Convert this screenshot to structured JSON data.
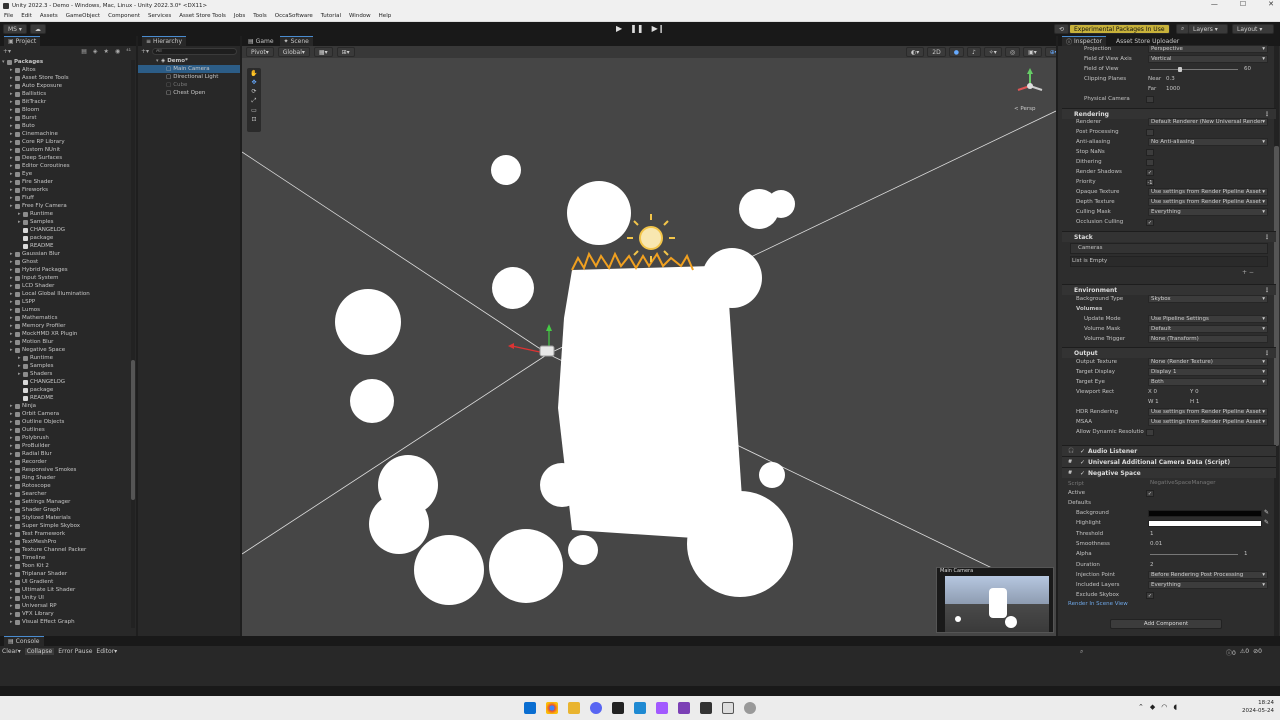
{
  "window": {
    "title": "Unity 2022.3 - Demo - Windows, Mac, Linux - Unity 2022.3.0* <DX11>"
  },
  "menu": [
    "File",
    "Edit",
    "Assets",
    "GameObject",
    "Component",
    "Services",
    "Asset Store Tools",
    "Jobs",
    "Tools",
    "OccaSoftware",
    "Tutorial",
    "Window",
    "Help"
  ],
  "toolbar": {
    "account": "MS",
    "experimental": "Experimental Packages In Use",
    "layers": "Layers",
    "layout": "Layout"
  },
  "project": {
    "tab": "Project",
    "root": "Packages",
    "items": [
      {
        "label": "Altos",
        "indent": 1
      },
      {
        "label": "Asset Store Tools",
        "indent": 1
      },
      {
        "label": "Auto Exposure",
        "indent": 1
      },
      {
        "label": "Ballistics",
        "indent": 1
      },
      {
        "label": "BitTrackr",
        "indent": 1
      },
      {
        "label": "Bloom",
        "indent": 1
      },
      {
        "label": "Burst",
        "indent": 1
      },
      {
        "label": "Buto",
        "indent": 1
      },
      {
        "label": "Cinemachine",
        "indent": 1
      },
      {
        "label": "Core RP Library",
        "indent": 1
      },
      {
        "label": "Custom NUnit",
        "indent": 1
      },
      {
        "label": "Deep Surfaces",
        "indent": 1
      },
      {
        "label": "Editor Coroutines",
        "indent": 1
      },
      {
        "label": "Eye",
        "indent": 1
      },
      {
        "label": "Fire Shader",
        "indent": 1
      },
      {
        "label": "Fireworks",
        "indent": 1
      },
      {
        "label": "Fluff",
        "indent": 1
      },
      {
        "label": "Free Fly Camera",
        "indent": 1
      },
      {
        "label": "Runtime",
        "indent": 2
      },
      {
        "label": "Samples",
        "indent": 2
      },
      {
        "label": "CHANGELOG",
        "indent": 2,
        "file": true
      },
      {
        "label": "package",
        "indent": 2,
        "file": true
      },
      {
        "label": "README",
        "indent": 2,
        "file": true
      },
      {
        "label": "Gaussian Blur",
        "indent": 1
      },
      {
        "label": "Ghost",
        "indent": 1
      },
      {
        "label": "Hybrid Packages",
        "indent": 1
      },
      {
        "label": "Input System",
        "indent": 1
      },
      {
        "label": "LCD Shader",
        "indent": 1
      },
      {
        "label": "Local Global Illumination",
        "indent": 1
      },
      {
        "label": "LSPP",
        "indent": 1
      },
      {
        "label": "Lumos",
        "indent": 1
      },
      {
        "label": "Mathematics",
        "indent": 1
      },
      {
        "label": "Memory Profiler",
        "indent": 1
      },
      {
        "label": "MockHMD XR Plugin",
        "indent": 1
      },
      {
        "label": "Motion Blur",
        "indent": 1
      },
      {
        "label": "Negative Space",
        "indent": 1
      },
      {
        "label": "Runtime",
        "indent": 2
      },
      {
        "label": "Samples",
        "indent": 2
      },
      {
        "label": "Shaders",
        "indent": 2
      },
      {
        "label": "CHANGELOG",
        "indent": 2,
        "file": true
      },
      {
        "label": "package",
        "indent": 2,
        "file": true
      },
      {
        "label": "README",
        "indent": 2,
        "file": true
      },
      {
        "label": "Ninja",
        "indent": 1
      },
      {
        "label": "Orbit Camera",
        "indent": 1
      },
      {
        "label": "Outline Objects",
        "indent": 1
      },
      {
        "label": "Outlines",
        "indent": 1
      },
      {
        "label": "Polybrush",
        "indent": 1
      },
      {
        "label": "ProBuilder",
        "indent": 1
      },
      {
        "label": "Radial Blur",
        "indent": 1
      },
      {
        "label": "Recorder",
        "indent": 1
      },
      {
        "label": "Responsive Smokes",
        "indent": 1
      },
      {
        "label": "Ring Shader",
        "indent": 1
      },
      {
        "label": "Rotoscope",
        "indent": 1
      },
      {
        "label": "Searcher",
        "indent": 1
      },
      {
        "label": "Settings Manager",
        "indent": 1
      },
      {
        "label": "Shader Graph",
        "indent": 1
      },
      {
        "label": "Stylized Materials",
        "indent": 1
      },
      {
        "label": "Super Simple Skybox",
        "indent": 1
      },
      {
        "label": "Test Framework",
        "indent": 1
      },
      {
        "label": "TextMeshPro",
        "indent": 1
      },
      {
        "label": "Texture Channel Packer",
        "indent": 1
      },
      {
        "label": "Timeline",
        "indent": 1
      },
      {
        "label": "Toon Kit 2",
        "indent": 1
      },
      {
        "label": "Triplanar Shader",
        "indent": 1
      },
      {
        "label": "UI Gradient",
        "indent": 1
      },
      {
        "label": "Ultimate Lit Shader",
        "indent": 1
      },
      {
        "label": "Unity UI",
        "indent": 1
      },
      {
        "label": "Universal RP",
        "indent": 1
      },
      {
        "label": "VFX Library",
        "indent": 1
      },
      {
        "label": "Visual Effect Graph",
        "indent": 1
      }
    ]
  },
  "hierarchy": {
    "tab": "Hierarchy",
    "search_placeholder": "All",
    "scene": "Demo*",
    "items": [
      {
        "label": "Main Camera",
        "selected": true
      },
      {
        "label": "Directional Light"
      },
      {
        "label": "Cube",
        "disabled": true
      },
      {
        "label": "Chest Open"
      }
    ]
  },
  "scene_view": {
    "tabs": [
      "Game",
      "Scene"
    ],
    "pivot": "Pivot",
    "global": "Global",
    "persp_label": "< Persp",
    "camera_preview_title": "Main Camera",
    "mode_2d": "2D"
  },
  "inspector": {
    "tabs": [
      "Inspector",
      "Asset Store Uploader"
    ],
    "camera": [
      {
        "label": "Projection",
        "value": "Perspective"
      },
      {
        "label": "Field of View Axis",
        "value": "Vertical"
      },
      {
        "label": "Field of View",
        "value": "60"
      },
      {
        "label": "Clipping Planes",
        "near_label": "Near",
        "near": "0.3",
        "far_label": "Far",
        "far": "1000"
      },
      {
        "label": "Physical Camera",
        "value": ""
      }
    ],
    "rendering_title": "Rendering",
    "rendering": [
      {
        "label": "Renderer",
        "value": "Default Renderer (New Universal Render"
      },
      {
        "label": "Post Processing",
        "value": ""
      },
      {
        "label": "Anti-aliasing",
        "value": "No Anti-aliasing"
      },
      {
        "label": "Stop NaNs",
        "value": ""
      },
      {
        "label": "Dithering",
        "value": ""
      },
      {
        "label": "Render Shadows",
        "value": "✓"
      },
      {
        "label": "Priority",
        "value": "-1"
      },
      {
        "label": "Opaque Texture",
        "value": "Use settings from Render Pipeline Asset"
      },
      {
        "label": "Depth Texture",
        "value": "Use settings from Render Pipeline Asset"
      },
      {
        "label": "Culling Mask",
        "value": "Everything"
      },
      {
        "label": "Occlusion Culling",
        "value": "✓"
      }
    ],
    "stack_title": "Stack",
    "stack_cameras": "Cameras",
    "stack_empty": "List is Empty",
    "environment_title": "Environment",
    "environment": [
      {
        "label": "Background Type",
        "value": "Skybox"
      },
      {
        "label": "Volumes",
        "value": ""
      },
      {
        "label": "Update Mode",
        "value": "Use Pipeline Settings"
      },
      {
        "label": "Volume Mask",
        "value": "Default"
      },
      {
        "label": "Volume Trigger",
        "value": "None (Transform)"
      }
    ],
    "output_title": "Output",
    "output": [
      {
        "label": "Output Texture",
        "value": "None (Render Texture)"
      },
      {
        "label": "Target Display",
        "value": "Display 1"
      },
      {
        "label": "Target Eye",
        "value": "Both"
      },
      {
        "label": "Viewport Rect",
        "x": "X 0",
        "y": "Y 0",
        "w": "W 1",
        "h": "H 1"
      },
      {
        "label": "HDR Rendering",
        "value": "Use settings from Render Pipeline Asset"
      },
      {
        "label": "MSAA",
        "value": "Use settings from Render Pipeline Asset"
      },
      {
        "label": "Allow Dynamic Resolutio",
        "value": ""
      }
    ],
    "components": [
      "Audio Listener",
      "Universal Additional Camera Data (Script)",
      "Negative Space"
    ],
    "negative_space": {
      "script_label": "Script",
      "script_value": "NegativeSpaceManager",
      "active_label": "Active",
      "defaults_label": "Defaults",
      "rows": [
        {
          "label": "Background",
          "value": ""
        },
        {
          "label": "Highlight",
          "value": ""
        },
        {
          "label": "Threshold",
          "value": "1"
        },
        {
          "label": "Smoothness",
          "value": "0.01"
        },
        {
          "label": "Alpha",
          "value": "1"
        },
        {
          "label": "Duration",
          "value": "2"
        },
        {
          "label": "Injection Point",
          "value": "Before Rendering Post Processing"
        },
        {
          "label": "Included Layers",
          "value": "Everything"
        },
        {
          "label": "Exclude Skybox",
          "value": "✓"
        }
      ],
      "render_in_scene": "Render In Scene View"
    },
    "add_component": "Add Component",
    "colors": {
      "background": "#050505",
      "highlight": "#ffffff"
    }
  },
  "console": {
    "tab": "Console",
    "buttons": [
      "Clear",
      "Collapse",
      "Error Pause",
      "Editor"
    ],
    "counts": [
      "0",
      "0",
      "0"
    ]
  },
  "taskbar": {
    "time": "18:24",
    "date": "2024-05-24"
  }
}
